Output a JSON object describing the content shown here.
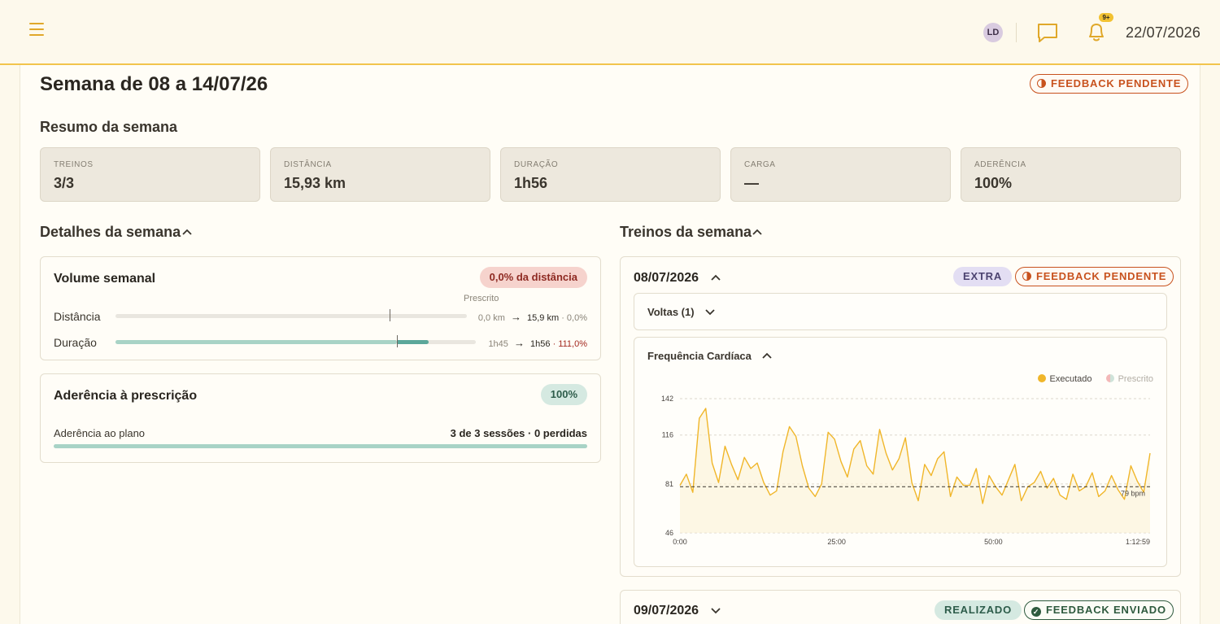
{
  "header": {
    "avatar_initials": "LD",
    "notification_count": "9+",
    "date": "22/07/2026"
  },
  "page": {
    "title": "Semana de 08 a 14/07/26",
    "status": "FEEDBACK PENDENTE"
  },
  "summary": {
    "title": "Resumo da semana",
    "tiles": [
      {
        "label": "TREINOS",
        "value": "3/3"
      },
      {
        "label": "DISTÂNCIA",
        "value": "15,93 km"
      },
      {
        "label": "DURAÇÃO",
        "value": "1h56"
      },
      {
        "label": "CARGA",
        "value": "—"
      },
      {
        "label": "ADERÊNCIA",
        "value": "100%"
      }
    ]
  },
  "details": {
    "title": "Detalhes da semana",
    "volume": {
      "title": "Volume semanal",
      "badge": "0,0% da distância",
      "prescribed_label": "Prescrito",
      "rows": [
        {
          "label": "Distância",
          "prescribed": "0,0 km",
          "executed": "15,9 km",
          "delta": "· 0,0%",
          "fill": 0.0,
          "marker": 0.78
        },
        {
          "label": "Duração",
          "prescribed": "1h45",
          "executed": "1h56",
          "delta": "· 111,0%",
          "fill": 0.87,
          "marker": 0.78
        }
      ]
    },
    "adherence": {
      "title": "Aderência à prescrição",
      "badge": "100%",
      "row_label": "Aderência ao plano",
      "row_value": "3 de 3 sessões · 0 perdidas",
      "fill": 1.0
    }
  },
  "workouts": {
    "title": "Treinos da semana",
    "items": [
      {
        "date": "08/07/2026",
        "tag": "EXTRA",
        "status": "FEEDBACK PENDENTE",
        "laps_label": "Voltas (1)",
        "hr_title": "Frequência Cardíaca",
        "legend_executed": "Executado",
        "legend_prescribed": "Prescrito"
      },
      {
        "date": "09/07/2026",
        "tag": "REALIZADO",
        "status": "FEEDBACK ENVIADO"
      }
    ]
  },
  "colors": {
    "accent": "#f2c44c",
    "hr_line": "#f0b62a",
    "pending": "#c8521e",
    "sent": "#2e5a3e"
  },
  "chart_data": {
    "type": "line",
    "title": "Frequência Cardíaca",
    "xlabel": "",
    "ylabel": "",
    "x_ticks": [
      "0:00",
      "25:00",
      "50:00",
      "1:12:59"
    ],
    "y_ticks": [
      142,
      116,
      81,
      46
    ],
    "ylim": [
      46,
      142
    ],
    "xlim_seconds": [
      0,
      4379
    ],
    "reference_line": {
      "value": 79,
      "label": "79 bpm"
    },
    "legend": [
      "Executado",
      "Prescrito"
    ],
    "legend_position": "top-right",
    "grid": true,
    "series": [
      {
        "name": "Executado",
        "x_seconds": [
          0,
          60,
          120,
          180,
          240,
          300,
          360,
          420,
          480,
          540,
          600,
          660,
          720,
          780,
          840,
          900,
          960,
          1020,
          1080,
          1140,
          1200,
          1260,
          1320,
          1380,
          1440,
          1500,
          1560,
          1620,
          1680,
          1740,
          1800,
          1860,
          1920,
          1980,
          2040,
          2100,
          2160,
          2220,
          2280,
          2340,
          2400,
          2460,
          2520,
          2580,
          2640,
          2700,
          2760,
          2820,
          2880,
          2940,
          3000,
          3060,
          3120,
          3180,
          3240,
          3300,
          3360,
          3420,
          3480,
          3540,
          3600,
          3660,
          3720,
          3780,
          3840,
          3900,
          3960,
          4020,
          4080,
          4140,
          4200,
          4260,
          4320,
          4379
        ],
        "values": [
          80,
          88,
          75,
          128,
          135,
          96,
          82,
          108,
          95,
          84,
          100,
          92,
          96,
          82,
          73,
          76,
          104,
          122,
          115,
          94,
          78,
          72,
          81,
          118,
          113,
          97,
          86,
          106,
          112,
          94,
          88,
          120,
          103,
          91,
          99,
          114,
          82,
          69,
          95,
          87,
          99,
          104,
          72,
          86,
          80,
          80,
          92,
          67,
          87,
          79,
          73,
          84,
          95,
          69,
          79,
          82,
          90,
          78,
          85,
          73,
          70,
          88,
          76,
          79,
          89,
          72,
          76,
          87,
          77,
          70,
          94,
          83,
          75,
          103
        ]
      }
    ]
  }
}
